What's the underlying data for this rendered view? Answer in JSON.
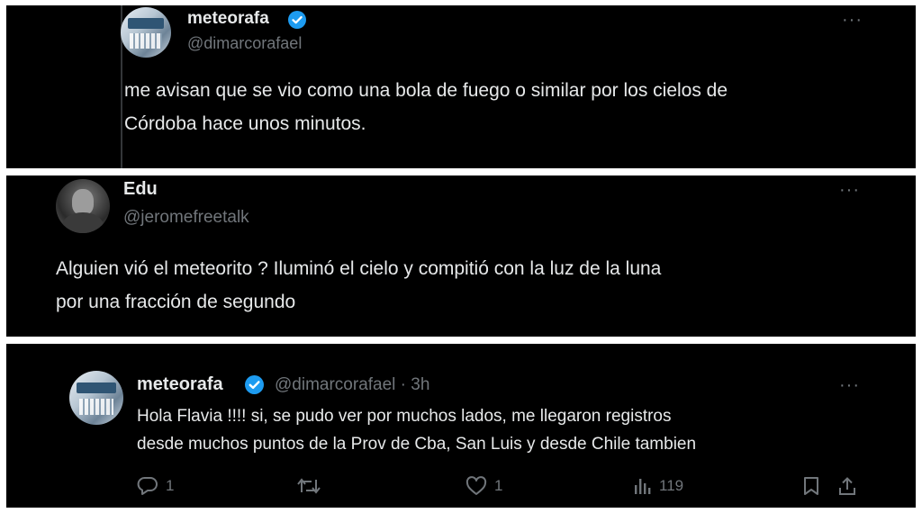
{
  "tweet1": {
    "display_name": "meteorafa",
    "handle": "@dimarcorafael",
    "text_line1": "me avisan que se vio como una bola de fuego o similar por los cielos de",
    "text_line2": "Córdoba hace unos minutos.",
    "more": "···"
  },
  "tweet2": {
    "display_name": "Edu",
    "handle": "@jeromefreetalk",
    "text_line1": "Alguien vió el meteorito ? Iluminó el cielo y compitió con la luz de la luna",
    "text_line2": "por una fracción de segundo",
    "more": "···"
  },
  "tweet3": {
    "display_name": "meteorafa",
    "handle_time": "@dimarcorafael · 3h",
    "text_line1": "Hola Flavia !!!!  si, se pudo ver por muchos lados, me llegaron registros",
    "text_line2": "desde muchos puntos de la Prov de Cba, San Luis y desde Chile tambien",
    "more": "···",
    "actions": {
      "reply_count": "1",
      "repost_count": "",
      "like_count": "1",
      "view_count": "119"
    }
  },
  "colors": {
    "background": "#000000",
    "text": "#e7e9ea",
    "secondary": "#71767b",
    "verified": "#1d9bf0"
  },
  "icons": [
    "verified-badge-icon",
    "more-options-icon",
    "reply-icon",
    "repost-icon",
    "like-icon",
    "views-icon",
    "bookmark-icon",
    "share-icon"
  ]
}
